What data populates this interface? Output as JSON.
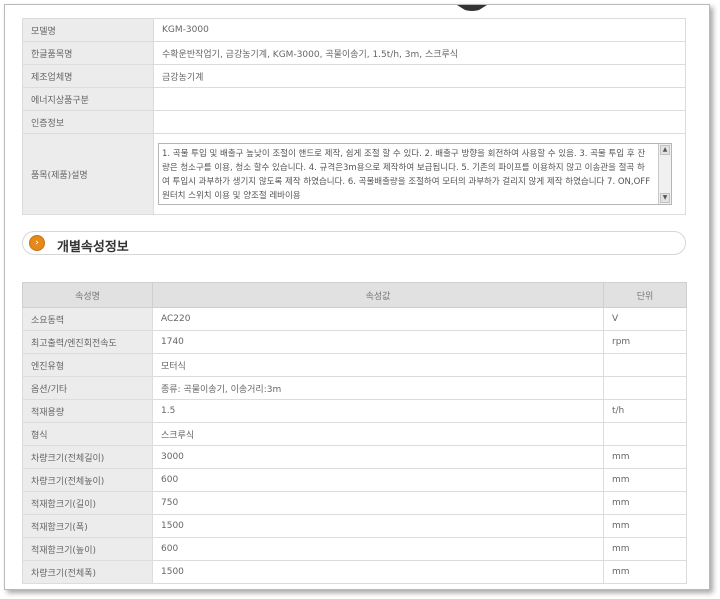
{
  "product_info": [
    {
      "label": "모델명",
      "value": "KGM-3000"
    },
    {
      "label": "한글품목명",
      "value": "수확운반작업기, 금강농기계, KGM-3000, 곡물이송기, 1.5t/h, 3m, 스크루식"
    },
    {
      "label": "제조업체명",
      "value": "금강농기계"
    },
    {
      "label": "에너지상품구분",
      "value": ""
    },
    {
      "label": "인증정보",
      "value": ""
    }
  ],
  "description": {
    "label": "품목(제품)설명",
    "text": "1. 곡물 투입 및 배출구 높낮이 조절이 핸드로 제작, 쉽게 조절 할 수 있다. 2. 배출구 방향을 회전하여 사용할 수 있음. 3. 곡물 투입 후 잔량은 청소구를 이용, 청소 할수 있습니다. 4. 규격은3m용으로 제작하여 보급됩니다. 5. 기존의 파이프를 이용하지 않고 이송관을 절곡 하여 투입시 과부하가 생기지 않도록 제작 하였습니다. 6. 곡물배출량을 조절하여 모터의 과부하가 걸리지 않게 제작 하였습니다 7. ON,OFF원터치 스위치 이용 및 양조절 레바이용"
  },
  "section": {
    "title": "개별속성정보",
    "icon": "arrow-circle-icon"
  },
  "attributes": {
    "headers": {
      "name": "속성명",
      "value": "속성값",
      "unit": "단위"
    },
    "rows": [
      {
        "name": "소요동력",
        "value": "AC220",
        "unit": "V"
      },
      {
        "name": "최고출력/엔진회전속도",
        "value": "1740",
        "unit": "rpm"
      },
      {
        "name": "엔진유형",
        "value": "모터식",
        "unit": ""
      },
      {
        "name": "옵션/기타",
        "value": "종류: 곡물이송기, 이송거리:3m",
        "unit": ""
      },
      {
        "name": "적재용량",
        "value": "1.5",
        "unit": "t/h"
      },
      {
        "name": "형식",
        "value": "스크루식",
        "unit": ""
      },
      {
        "name": "차량크기(전체길이)",
        "value": "3000",
        "unit": "mm"
      },
      {
        "name": "차량크기(전체높이)",
        "value": "600",
        "unit": "mm"
      },
      {
        "name": "적재함크기(길이)",
        "value": "750",
        "unit": "mm"
      },
      {
        "name": "적재함크기(폭)",
        "value": "1500",
        "unit": "mm"
      },
      {
        "name": "적재함크기(높이)",
        "value": "600",
        "unit": "mm"
      },
      {
        "name": "차량크기(전체폭)",
        "value": "1500",
        "unit": "mm"
      }
    ]
  },
  "colors": {
    "accent": "#e48a1c",
    "label_bg": "#ececec",
    "header_bg": "#e1e1e1"
  }
}
